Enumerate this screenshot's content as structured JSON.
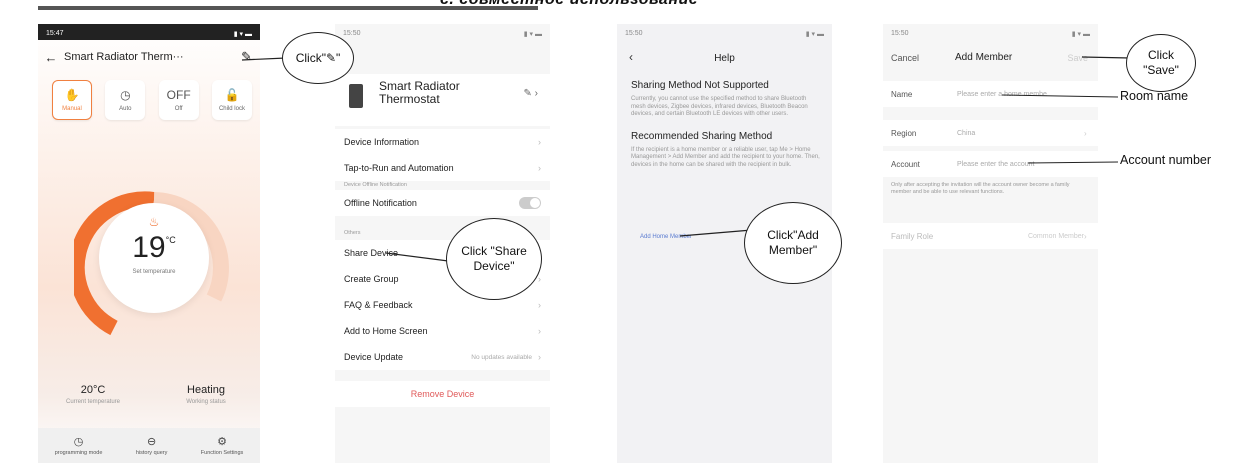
{
  "heading": "с. совместное использование",
  "screen1": {
    "status_time": "15:47",
    "title": "Smart Radiator Therm···",
    "modes": [
      {
        "icon": "hand-icon",
        "glyph": "✋",
        "label": "Manual",
        "active": true
      },
      {
        "icon": "clock-icon",
        "glyph": "◷",
        "label": "Auto",
        "active": false
      },
      {
        "icon": "off-icon",
        "glyph": "OFF",
        "label": "Off",
        "active": false
      },
      {
        "icon": "lock-icon",
        "glyph": "🔓",
        "label": "Child lock",
        "active": false
      }
    ],
    "set_temperature": "19",
    "temp_unit": "°C",
    "set_temperature_label": "Set temperature",
    "current_temperature": "20°C",
    "current_temperature_label": "Current temperature",
    "working_status": "Heating",
    "working_status_label": "Working status",
    "bottom_nav": [
      {
        "icon": "clock-icon",
        "glyph": "◷",
        "label": "programming mode"
      },
      {
        "icon": "history-icon",
        "glyph": "⊖",
        "label": "history query"
      },
      {
        "icon": "settings-icon",
        "glyph": "⚙",
        "label": "Function Settings"
      }
    ]
  },
  "screen2": {
    "status_time": "15:50",
    "device_name": "Smart Radiator Thermostat",
    "group1": [
      "Device Information",
      "Tap-to-Run and Automation"
    ],
    "section_offline": "Device Offline Notification",
    "offline_notification": "Offline Notification",
    "section_others": "Others",
    "group3": [
      "Share Device",
      "Create Group",
      "FAQ & Feedback",
      "Add to Home Screen"
    ],
    "device_update": "Device Update",
    "device_update_status": "No updates available",
    "remove_device": "Remove Device"
  },
  "screen3": {
    "status_time": "15:50",
    "title": "Help",
    "h1": "Sharing Method Not Supported",
    "p1": "Currently, you cannot use the specified method to share Bluetooth mesh devices, Zigbee devices, infrared devices, Bluetooth Beacon devices, and certain Bluetooth LE devices with other users.",
    "h2": "Recommended Sharing Method",
    "p2": "If the recipient is a home member or a reliable user, tap Me > Home Management > Add Member and add the recipient to your home. Then, devices in the home can be shared with the recipient in bulk.",
    "link": "Add Home Member"
  },
  "screen4": {
    "status_time": "15:50",
    "cancel": "Cancel",
    "title": "Add Member",
    "save": "Save",
    "name_label": "Name",
    "name_placeholder": "Please enter a home membe",
    "region_label": "Region",
    "region_value": "China",
    "account_label": "Account",
    "account_placeholder": "Please enter the account",
    "note": "Only after accepting the invitation will the account owner become a family member and be able to use relevant functions.",
    "family_role_label": "Family Role",
    "family_role_value": "Common Member"
  },
  "callouts": {
    "click_edit": "Click\"✎\"",
    "click_share": "Click \"Share Device\"",
    "click_add_member": "Click\"Add Member\"",
    "click_save": "Click \"Save\"",
    "room_name": "Room name",
    "account_number": "Account number"
  },
  "colors": {
    "accent_orange": "#f07030",
    "remove_red": "#e05a5a",
    "link_blue": "#5a7bd0"
  }
}
